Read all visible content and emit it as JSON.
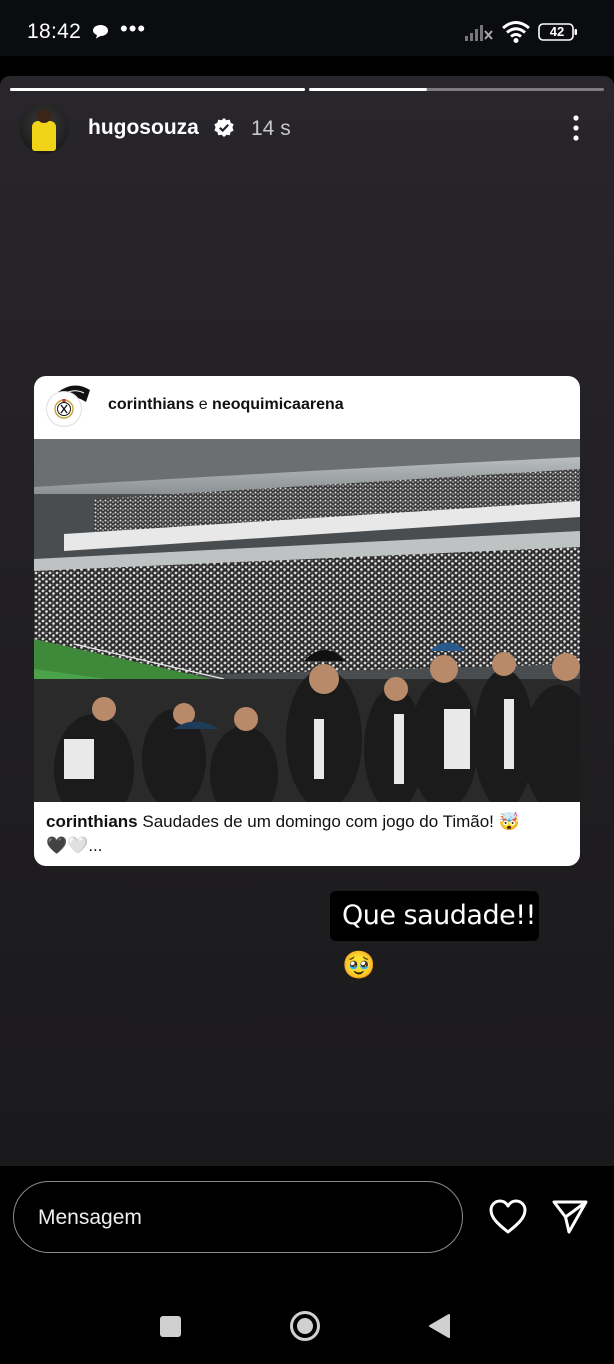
{
  "status_bar": {
    "time": "18:42",
    "dots": "•••",
    "battery": "42",
    "icons": [
      "chat-bubble-icon",
      "signal-off-icon",
      "wifi-icon",
      "battery-icon"
    ]
  },
  "story": {
    "progress": [
      1.0,
      0.4
    ],
    "username": "hugosouza",
    "verified": true,
    "time_ago": "14 s"
  },
  "shared_post": {
    "author_primary": "corinthians",
    "joiner": "e",
    "author_secondary": "neoquimicaarena",
    "caption_user": "corinthians",
    "caption_text": "Saudades de um domingo com jogo do Timão! 🤯",
    "caption_line2": "🖤🤍...",
    "photo": "Stadium crowd photo"
  },
  "sticker": {
    "text": "Que saudade!!🥹"
  },
  "composer": {
    "placeholder": "Mensagem"
  },
  "colors": {
    "background": "#000000",
    "story_bg": "#252327",
    "card_bg": "#ffffff",
    "jersey": "#f1d318"
  }
}
